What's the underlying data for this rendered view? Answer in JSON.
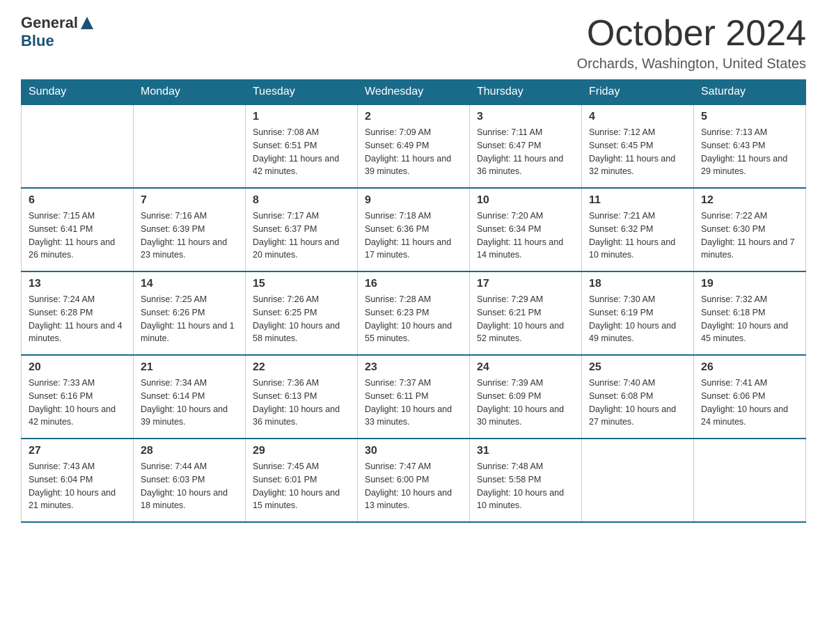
{
  "logo": {
    "general": "General",
    "blue": "Blue"
  },
  "title": "October 2024",
  "location": "Orchards, Washington, United States",
  "days_of_week": [
    "Sunday",
    "Monday",
    "Tuesday",
    "Wednesday",
    "Thursday",
    "Friday",
    "Saturday"
  ],
  "weeks": [
    [
      {
        "day": "",
        "info": ""
      },
      {
        "day": "",
        "info": ""
      },
      {
        "day": "1",
        "info": "Sunrise: 7:08 AM\nSunset: 6:51 PM\nDaylight: 11 hours\nand 42 minutes."
      },
      {
        "day": "2",
        "info": "Sunrise: 7:09 AM\nSunset: 6:49 PM\nDaylight: 11 hours\nand 39 minutes."
      },
      {
        "day": "3",
        "info": "Sunrise: 7:11 AM\nSunset: 6:47 PM\nDaylight: 11 hours\nand 36 minutes."
      },
      {
        "day": "4",
        "info": "Sunrise: 7:12 AM\nSunset: 6:45 PM\nDaylight: 11 hours\nand 32 minutes."
      },
      {
        "day": "5",
        "info": "Sunrise: 7:13 AM\nSunset: 6:43 PM\nDaylight: 11 hours\nand 29 minutes."
      }
    ],
    [
      {
        "day": "6",
        "info": "Sunrise: 7:15 AM\nSunset: 6:41 PM\nDaylight: 11 hours\nand 26 minutes."
      },
      {
        "day": "7",
        "info": "Sunrise: 7:16 AM\nSunset: 6:39 PM\nDaylight: 11 hours\nand 23 minutes."
      },
      {
        "day": "8",
        "info": "Sunrise: 7:17 AM\nSunset: 6:37 PM\nDaylight: 11 hours\nand 20 minutes."
      },
      {
        "day": "9",
        "info": "Sunrise: 7:18 AM\nSunset: 6:36 PM\nDaylight: 11 hours\nand 17 minutes."
      },
      {
        "day": "10",
        "info": "Sunrise: 7:20 AM\nSunset: 6:34 PM\nDaylight: 11 hours\nand 14 minutes."
      },
      {
        "day": "11",
        "info": "Sunrise: 7:21 AM\nSunset: 6:32 PM\nDaylight: 11 hours\nand 10 minutes."
      },
      {
        "day": "12",
        "info": "Sunrise: 7:22 AM\nSunset: 6:30 PM\nDaylight: 11 hours\nand 7 minutes."
      }
    ],
    [
      {
        "day": "13",
        "info": "Sunrise: 7:24 AM\nSunset: 6:28 PM\nDaylight: 11 hours\nand 4 minutes."
      },
      {
        "day": "14",
        "info": "Sunrise: 7:25 AM\nSunset: 6:26 PM\nDaylight: 11 hours\nand 1 minute."
      },
      {
        "day": "15",
        "info": "Sunrise: 7:26 AM\nSunset: 6:25 PM\nDaylight: 10 hours\nand 58 minutes."
      },
      {
        "day": "16",
        "info": "Sunrise: 7:28 AM\nSunset: 6:23 PM\nDaylight: 10 hours\nand 55 minutes."
      },
      {
        "day": "17",
        "info": "Sunrise: 7:29 AM\nSunset: 6:21 PM\nDaylight: 10 hours\nand 52 minutes."
      },
      {
        "day": "18",
        "info": "Sunrise: 7:30 AM\nSunset: 6:19 PM\nDaylight: 10 hours\nand 49 minutes."
      },
      {
        "day": "19",
        "info": "Sunrise: 7:32 AM\nSunset: 6:18 PM\nDaylight: 10 hours\nand 45 minutes."
      }
    ],
    [
      {
        "day": "20",
        "info": "Sunrise: 7:33 AM\nSunset: 6:16 PM\nDaylight: 10 hours\nand 42 minutes."
      },
      {
        "day": "21",
        "info": "Sunrise: 7:34 AM\nSunset: 6:14 PM\nDaylight: 10 hours\nand 39 minutes."
      },
      {
        "day": "22",
        "info": "Sunrise: 7:36 AM\nSunset: 6:13 PM\nDaylight: 10 hours\nand 36 minutes."
      },
      {
        "day": "23",
        "info": "Sunrise: 7:37 AM\nSunset: 6:11 PM\nDaylight: 10 hours\nand 33 minutes."
      },
      {
        "day": "24",
        "info": "Sunrise: 7:39 AM\nSunset: 6:09 PM\nDaylight: 10 hours\nand 30 minutes."
      },
      {
        "day": "25",
        "info": "Sunrise: 7:40 AM\nSunset: 6:08 PM\nDaylight: 10 hours\nand 27 minutes."
      },
      {
        "day": "26",
        "info": "Sunrise: 7:41 AM\nSunset: 6:06 PM\nDaylight: 10 hours\nand 24 minutes."
      }
    ],
    [
      {
        "day": "27",
        "info": "Sunrise: 7:43 AM\nSunset: 6:04 PM\nDaylight: 10 hours\nand 21 minutes."
      },
      {
        "day": "28",
        "info": "Sunrise: 7:44 AM\nSunset: 6:03 PM\nDaylight: 10 hours\nand 18 minutes."
      },
      {
        "day": "29",
        "info": "Sunrise: 7:45 AM\nSunset: 6:01 PM\nDaylight: 10 hours\nand 15 minutes."
      },
      {
        "day": "30",
        "info": "Sunrise: 7:47 AM\nSunset: 6:00 PM\nDaylight: 10 hours\nand 13 minutes."
      },
      {
        "day": "31",
        "info": "Sunrise: 7:48 AM\nSunset: 5:58 PM\nDaylight: 10 hours\nand 10 minutes."
      },
      {
        "day": "",
        "info": ""
      },
      {
        "day": "",
        "info": ""
      }
    ]
  ]
}
